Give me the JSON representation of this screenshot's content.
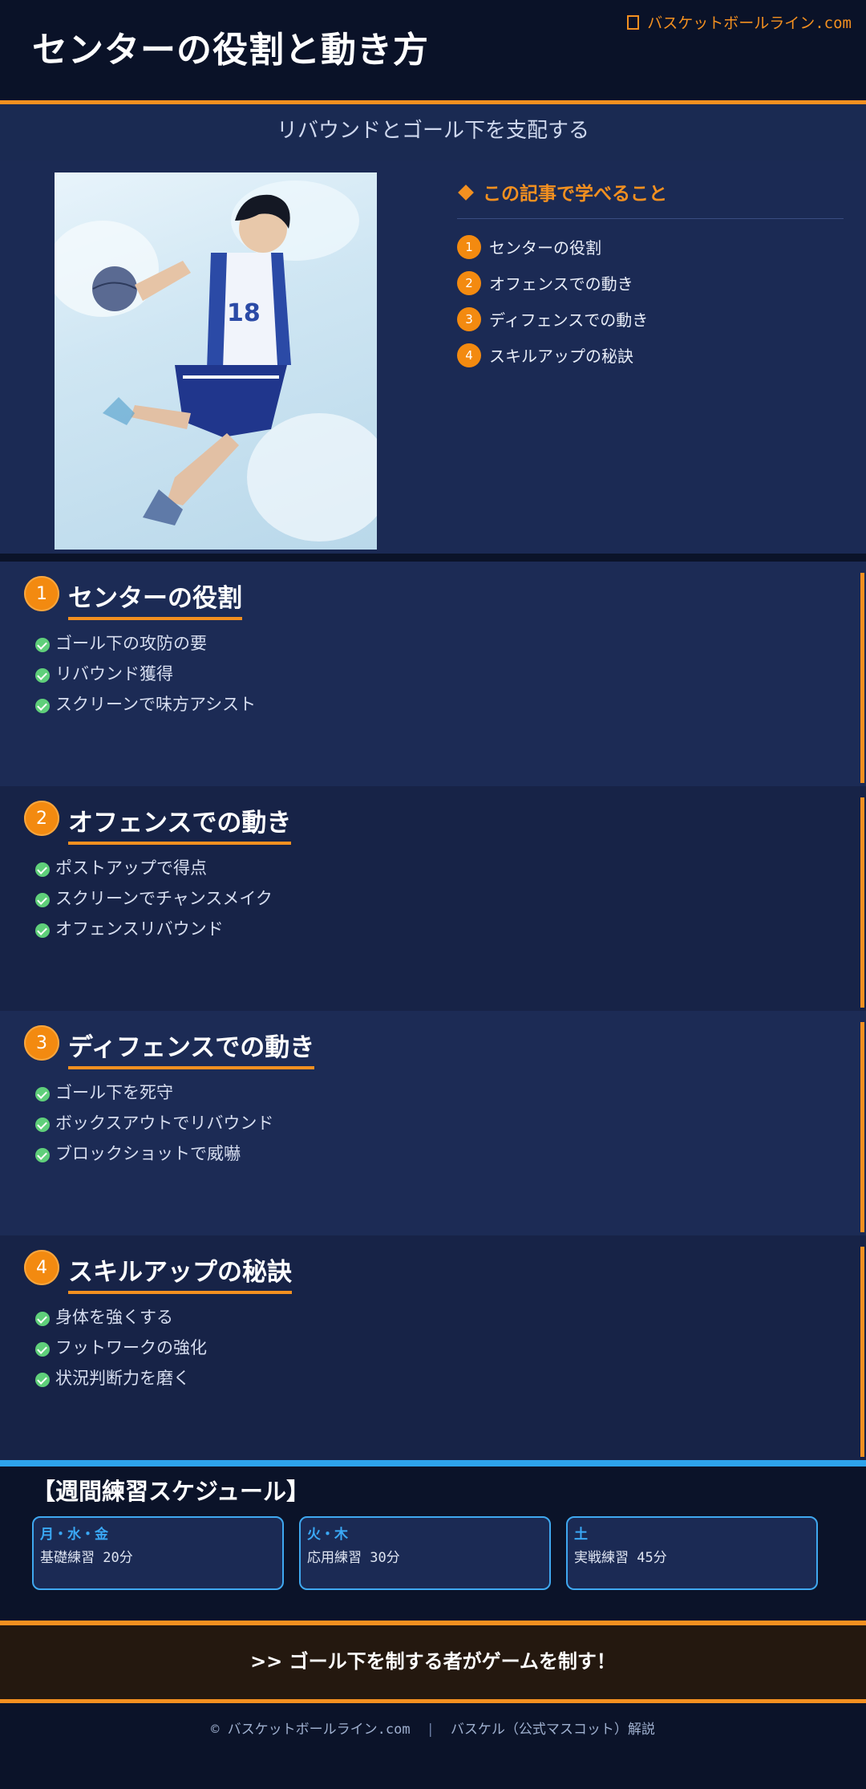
{
  "header": {
    "title": "センターの役割と動き方",
    "site_name": "バスケットボールライン.com"
  },
  "subtitle": "リバウンドとゴール下を支配する",
  "hero_image": {
    "alt": "basketball-player-illustration"
  },
  "toc": {
    "heading": "この記事で学べること",
    "items": [
      {
        "num": "1",
        "label": "センターの役割"
      },
      {
        "num": "2",
        "label": "オフェンスでの動き"
      },
      {
        "num": "3",
        "label": "ディフェンスでの動き"
      },
      {
        "num": "4",
        "label": "スキルアップの秘訣"
      }
    ]
  },
  "sections": [
    {
      "num": "1",
      "title": "センターの役割",
      "bullets": [
        "ゴール下の攻防の要",
        "リバウンド獲得",
        "スクリーンで味方アシスト"
      ]
    },
    {
      "num": "2",
      "title": "オフェンスでの動き",
      "bullets": [
        "ポストアップで得点",
        "スクリーンでチャンスメイク",
        "オフェンスリバウンド"
      ]
    },
    {
      "num": "3",
      "title": "ディフェンスでの動き",
      "bullets": [
        "ゴール下を死守",
        "ボックスアウトでリバウンド",
        "ブロックショットで威嚇"
      ]
    },
    {
      "num": "4",
      "title": "スキルアップの秘訣",
      "bullets": [
        "身体を強くする",
        "フットワークの強化",
        "状況判断力を磨く"
      ]
    }
  ],
  "schedule": {
    "title": "【週間練習スケジュール】",
    "cards": [
      {
        "days": "月・水・金",
        "desc": "基礎練習 20分"
      },
      {
        "days": "火・木",
        "desc": "応用練習 30分"
      },
      {
        "days": "土",
        "desc": "実戦練習 45分"
      }
    ]
  },
  "banner": ">> ゴール下を制する者がゲームを制す！",
  "footer": {
    "copyright": "© バスケットボールライン.com",
    "separator": "|",
    "credit": "バスケル（公式マスコット）解説"
  },
  "colors": {
    "accent": "#f39020",
    "blue_accent": "#2ea3ec",
    "background": "#0b1329",
    "panel": "#1b2a54",
    "check": "#5fcf7a"
  }
}
